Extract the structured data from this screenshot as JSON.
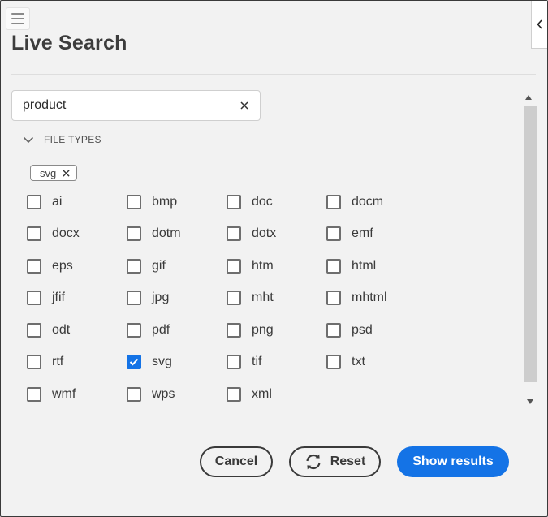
{
  "header": {
    "title": "Live Search",
    "menu_icon": "hamburger-menu-icon",
    "collapse_icon": "chevron-left-icon"
  },
  "search": {
    "value": "product",
    "clear_icon": "close-icon"
  },
  "filters": {
    "section_label": "FILE TYPES",
    "expanded": true,
    "selected_chips": [
      {
        "label": "svg"
      }
    ],
    "file_types": [
      {
        "label": "ai",
        "checked": false
      },
      {
        "label": "bmp",
        "checked": false
      },
      {
        "label": "doc",
        "checked": false
      },
      {
        "label": "docm",
        "checked": false
      },
      {
        "label": "docx",
        "checked": false
      },
      {
        "label": "dotm",
        "checked": false
      },
      {
        "label": "dotx",
        "checked": false
      },
      {
        "label": "emf",
        "checked": false
      },
      {
        "label": "eps",
        "checked": false
      },
      {
        "label": "gif",
        "checked": false
      },
      {
        "label": "htm",
        "checked": false
      },
      {
        "label": "html",
        "checked": false
      },
      {
        "label": "jfif",
        "checked": false
      },
      {
        "label": "jpg",
        "checked": false
      },
      {
        "label": "mht",
        "checked": false
      },
      {
        "label": "mhtml",
        "checked": false
      },
      {
        "label": "odt",
        "checked": false
      },
      {
        "label": "pdf",
        "checked": false
      },
      {
        "label": "png",
        "checked": false
      },
      {
        "label": "psd",
        "checked": false
      },
      {
        "label": "rtf",
        "checked": false
      },
      {
        "label": "svg",
        "checked": true
      },
      {
        "label": "tif",
        "checked": false
      },
      {
        "label": "txt",
        "checked": false
      },
      {
        "label": "wmf",
        "checked": false
      },
      {
        "label": "wps",
        "checked": false
      },
      {
        "label": "xml",
        "checked": false
      }
    ]
  },
  "actions": {
    "cancel_label": "Cancel",
    "reset_label": "Reset",
    "reset_icon": "refresh-icon",
    "show_results_label": "Show results"
  },
  "colors": {
    "accent": "#1473e6",
    "background": "#f2f2f2"
  }
}
